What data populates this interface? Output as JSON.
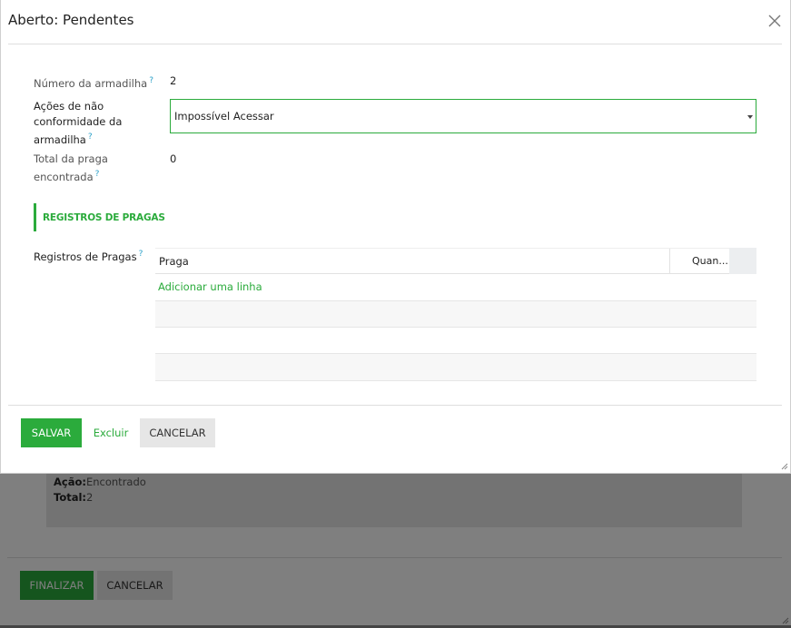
{
  "background": {
    "lines": [
      {
        "key": "Ação:",
        "value": "Encontrado"
      },
      {
        "key": "Total:",
        "value": "2"
      }
    ],
    "finalize_label": "FINALIZAR",
    "cancel_label": "CANCELAR"
  },
  "modal": {
    "title": "Aberto: Pendentes",
    "fields": {
      "trap_number": {
        "label": "Número da armadilha",
        "value": "2"
      },
      "nonconformity": {
        "label_lines": [
          "Ações de não",
          "conformidade da",
          "armadilha"
        ],
        "selected": "Impossível Acessar"
      },
      "pest_total": {
        "label_lines": [
          "Total da praga",
          "encontrada"
        ],
        "value": "0"
      }
    },
    "help_glyph": "?",
    "section_title": "REGISTROS DE PRAGAS",
    "records": {
      "label": "Registros de Pragas",
      "columns": [
        "Praga",
        "Quan..."
      ],
      "add_line": "Adicionar uma linha"
    },
    "buttons": {
      "save": "SALVAR",
      "delete": "Excluir",
      "cancel": "CANCELAR"
    }
  },
  "colors": {
    "accent": "#2bab3c",
    "help": "#2aa0c8"
  },
  "icons": {
    "close": "close-icon",
    "dropdown": "caret-down-icon",
    "resize": "resize-handle-icon"
  }
}
